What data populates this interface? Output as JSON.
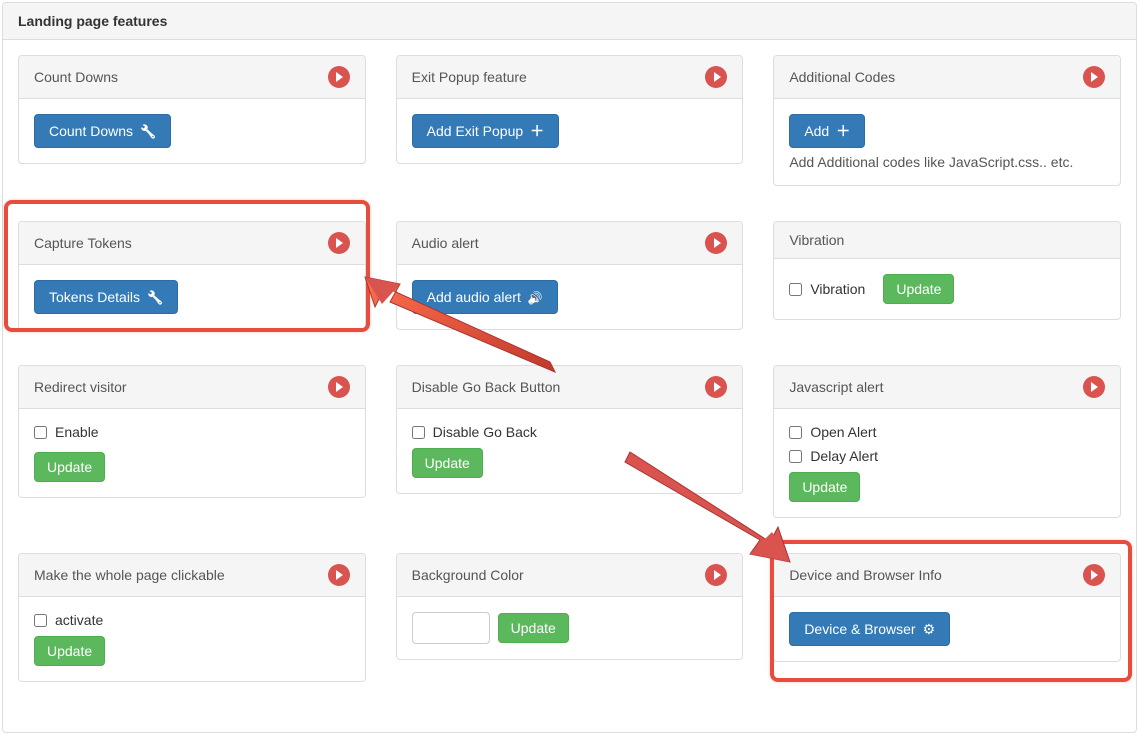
{
  "page": {
    "title": "Landing page features"
  },
  "colors": {
    "primary": "#337ab7",
    "success": "#5cb85c",
    "danger": "#d9534f"
  },
  "cards": {
    "count_downs": {
      "title": "Count Downs",
      "button": "Count Downs"
    },
    "exit_popup": {
      "title": "Exit Popup feature",
      "button": "Add Exit Popup"
    },
    "additional": {
      "title": "Additional Codes",
      "button": "Add",
      "note": "Add Additional codes like JavaScript.css.. etc."
    },
    "capture": {
      "title": "Capture Tokens",
      "button": "Tokens Details"
    },
    "audio": {
      "title": "Audio alert",
      "button": "Add audio alert"
    },
    "vibration": {
      "title": "Vibration",
      "checkbox": "Vibration",
      "update": "Update"
    },
    "redirect": {
      "title": "Redirect visitor",
      "checkbox": "Enable",
      "update": "Update"
    },
    "goback": {
      "title": "Disable Go Back Button",
      "checkbox": "Disable Go Back",
      "update": "Update"
    },
    "jsalert": {
      "title": "Javascript alert",
      "check1": "Open Alert",
      "check2": "Delay Alert",
      "update": "Update"
    },
    "clickable": {
      "title": "Make the whole page clickable",
      "checkbox": "activate",
      "update": "Update"
    },
    "bgcolor": {
      "title": "Background Color",
      "update": "Update",
      "value": ""
    },
    "device": {
      "title": "Device and Browser Info",
      "button": "Device & Browser"
    }
  }
}
